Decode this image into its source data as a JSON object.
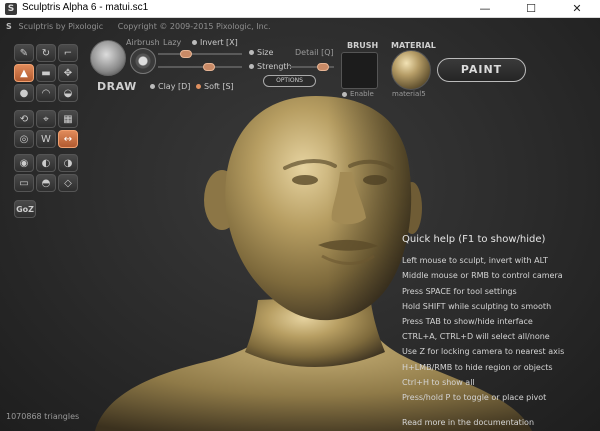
{
  "window": {
    "title": "Sculptris Alpha 6 - matui.sc1",
    "app_icon": "S",
    "controls": {
      "minimize": "—",
      "maximize": "☐",
      "close": "✕"
    }
  },
  "topbar": {
    "logo": "S",
    "product": "Sculptris by Pixologic",
    "copyright": "Copyright © 2009-2015 Pixologic, Inc."
  },
  "toolgrid": {
    "icons": [
      "crease-icon",
      "rotate-icon",
      "pinch-icon",
      "draw-icon",
      "flatten-icon",
      "grab-icon",
      "inflate-icon",
      "smooth-icon",
      "reduce-icon",
      "symmetry-icon",
      "wireframe-icon",
      "grid-icon",
      "mask-icon",
      "invert-mask-icon",
      "show-all-icon",
      "sphere-icon",
      "plane-icon",
      "mesh-icon",
      "subdivide-icon",
      "reduce-selected-icon",
      "reduce-brush-icon"
    ],
    "goz_label": "GoZ",
    "active_indices": [
      3,
      14
    ]
  },
  "draw": {
    "label": "DRAW",
    "airbrush_label": "Airbrush",
    "lazy_label": "Lazy",
    "invert_label": "Invert [X]",
    "size_label": "Size",
    "detail_label": "Detail [Q]",
    "strength_label": "Strength",
    "options_label": "OPTIONS",
    "clay_label": "Clay [D]",
    "soft_label": "Soft [S]",
    "size_value": 0.3,
    "strength_value": 0.62,
    "detail_value": 0.85
  },
  "brush": {
    "header": "BRUSH",
    "enable_label": "Enable"
  },
  "material": {
    "header": "MATERIAL",
    "name": "material5"
  },
  "paint_label": "PAINT",
  "help": {
    "title": "Quick help (F1 to show/hide)",
    "lines": [
      "Left mouse to sculpt, invert with ALT",
      "Middle mouse or RMB to control camera",
      "Press SPACE for tool settings",
      "Hold SHIFT while sculpting to smooth",
      "Press TAB to show/hide interface",
      "CTRL+A, CTRL+D will select all/none",
      "Use Z for locking camera to nearest axis",
      "H+LMB/RMB to hide region or objects",
      "Ctrl+H to show all",
      "Press/hold P to toggle or place pivot"
    ],
    "more": "Read more in the documentation"
  },
  "status": {
    "triangles": "1070868 triangles"
  },
  "colors": {
    "accent": "#e08a5a",
    "model": "#b79e62"
  }
}
